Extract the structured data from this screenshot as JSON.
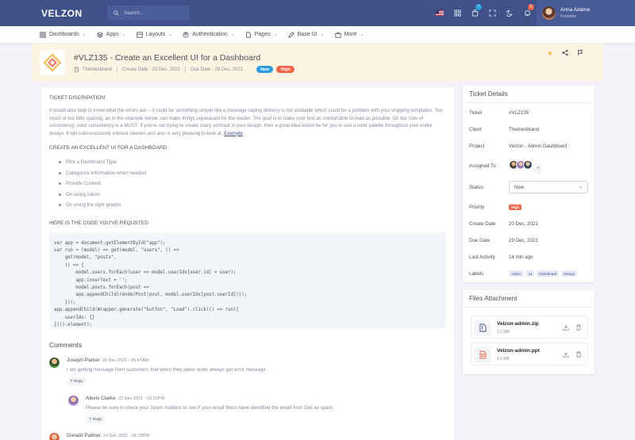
{
  "topbar": {
    "brand": "VELZON",
    "search_placeholder": "Search...",
    "cart_badge": "7",
    "notif_badge": "3",
    "user_name": "Anna Adame",
    "user_role": "Founder"
  },
  "nav": {
    "items": [
      {
        "label": "Dashboards"
      },
      {
        "label": "Apps"
      },
      {
        "label": "Layouts"
      },
      {
        "label": "Authentication"
      },
      {
        "label": "Pages"
      },
      {
        "label": "Base UI"
      },
      {
        "label": "More"
      }
    ]
  },
  "ticket": {
    "title": "#VLZ135 - Create an Excellent UI for a Dashboard",
    "company": "Themesbrand",
    "create_date_label": "Create Date :",
    "create_date": "20 Dec, 2021",
    "due_date_label": "Due Date :",
    "due_date": "29 Dec, 2021",
    "badge_new": "New",
    "badge_high": "High"
  },
  "content": {
    "desc_heading": "TICKET DISCRIPATION",
    "description": "It would also help to know what the errors are – it could be something simple like a message saying delivery is not available which could be a problem with your shipping templates. Too much or too little spacing, as in the example below, can make things unpleasant for the reader. The goal is to make your text as comfortable to read as possible. On the note of consistency, color consistency is a MUST. If you're not trying to create crazy contrast in your design, then a great idea would be for you to use a color palette throughout your entire design. It will subconsciously interest viewers and also is very pleasing to look at.",
    "example_link": "Example",
    "create_heading": "CREATE AN EXCELLENT UI FOR A DASHBOARD",
    "bullets": [
      "Pick a Dashboard Type",
      "Categorize information when needed",
      "Provide Context",
      "On using colors",
      "On using the right graphs"
    ],
    "code_heading": "HERE IS THE CODE YOU'VE REQUSTED",
    "code": "var app = document.getElementById(\"app\");\nvar run = (model) => get(model, \"users\", () =>\n    get(model, \"posts\",\n    () => {\n        model.users.forEach(user => model.userIdx[user.id] = user);\n        app.innerText = '';\n        model.posts.forEach(post =>\n        app.appendChild(renderPost(post, model.userIdx[post.userId])));\n    }));\napp.appendChild(Wrapper.generate(\"button\", \"Load\").click(() => run({\n    userIdx: {}\n}))).element);"
  },
  "comments": {
    "title": "Comments",
    "reply_label": "Reply",
    "list": [
      {
        "name": "Joseph Parker",
        "date": "20 Dec 2021 - 05:47AM",
        "text": "I am getting message from customers that when they place order always get error message ."
      },
      {
        "name": "Alexis Clarke",
        "date": "22 Dec 2021 - 02:32PM",
        "text": "Please be sure to check your Spam mailbox to see if your email filters have identified the email from Dell as spam."
      },
      {
        "name": "Donald Palmer",
        "date": "24 Dec 2021 - 05:20PM",
        "text": ""
      }
    ]
  },
  "details": {
    "title": "Ticket Details",
    "ticket_label": "Ticket",
    "ticket_value": "#VLZ135",
    "client_label": "Client",
    "client_value": "Themesbrand",
    "project_label": "Project",
    "project_value": "Velzon - Admin Dashboard",
    "assigned_label": "Assigned To:",
    "status_label": "Status:",
    "status_value": "New",
    "priority_label": "Priority",
    "priority_value": "High",
    "create_label": "Create Date",
    "create_value": "20 Dec, 2021",
    "due_label": "Due Date",
    "due_value": "29 Dec, 2021",
    "activity_label": "Last Activity",
    "activity_value": "14 min ago",
    "labels_label": "Labels",
    "tags": [
      "Admin",
      "UI",
      "Dashboard",
      "Design"
    ]
  },
  "files": {
    "title": "Files Attachment",
    "list": [
      {
        "name": "Velzon-admin.zip",
        "size": "3.2 MB"
      },
      {
        "name": "Velzon-admin.ppt",
        "size": "4.5 MB"
      }
    ]
  },
  "colors": {
    "primary": "#405189",
    "success": "#0ab39c",
    "danger": "#f06548",
    "info": "#299cdb",
    "warning": "#f7b84b"
  }
}
